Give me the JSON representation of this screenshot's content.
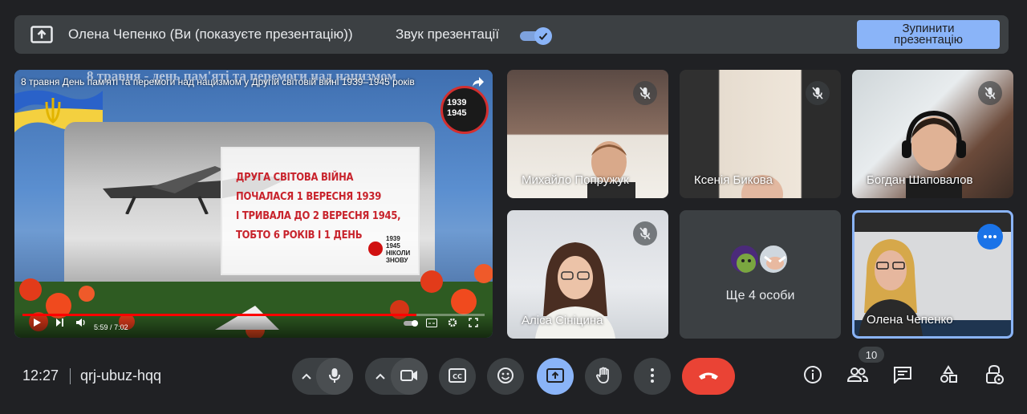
{
  "presentation_bar": {
    "presenter_text": "Олена Чепенко (Ви (показуєте презентацію))",
    "audio_label": "Звук презентації",
    "audio_on": true,
    "stop_button": "Зупинити презентацію"
  },
  "shared_screen": {
    "banner": "8 травня - день пам'яті та перемоги над нацизмом",
    "video_title": "8 травня День пам'яті та перемоги над нацизмом у Другій світовій війні 1939–1945 років",
    "badge_years": [
      "1939",
      "1945"
    ],
    "slide_lines": [
      "ДРУГА СВІТОВА ВІЙНА",
      "ПОЧАЛАСЯ 1 ВЕРЕСНЯ 1939",
      "І ТРИВАЛА ДО 2 ВЕРЕСНЯ 1945,",
      "ТОБТО 6 РОКІВ І 1 ДЕНЬ"
    ],
    "logo_years": [
      "1939",
      "1945"
    ],
    "logo_words": [
      "НІКОЛИ",
      "ЗНОВУ"
    ],
    "player": {
      "current_time": "5:59",
      "separator": "/",
      "duration": "7:02",
      "progress_fraction": 0.852
    }
  },
  "participants": [
    {
      "name": "Михайло Попружук",
      "muted": true
    },
    {
      "name": "Ксенія Бикова",
      "muted": true
    },
    {
      "name": "Богдан Шаповалов",
      "muted": true
    },
    {
      "name": "Аліса Сініцина",
      "muted": true
    },
    {
      "name": "Олена Чепенко",
      "muted": false,
      "speaking": true
    }
  ],
  "others_tile": {
    "label": "Ще 4 особи"
  },
  "bottom_bar": {
    "time": "12:27",
    "meeting_code": "qrj-ubuz-hqq",
    "participant_count": "10"
  },
  "colors": {
    "background": "#202124",
    "surface": "#3c4043",
    "accent": "#8ab4f8",
    "end_call": "#ea4335"
  },
  "icons": [
    "present-icon",
    "share-icon",
    "mic-off-icon",
    "mic-icon",
    "camera-icon",
    "captions-icon",
    "emoji-icon",
    "present-now-icon",
    "raise-hand-icon",
    "more-options-icon",
    "end-call-icon",
    "info-icon",
    "people-icon",
    "chat-icon",
    "activities-icon",
    "host-controls-icon"
  ]
}
